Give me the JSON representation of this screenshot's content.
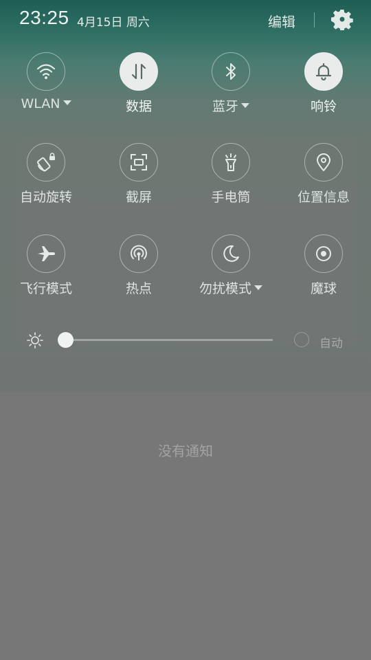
{
  "status": {
    "time": "23:25",
    "date": "4月15日",
    "weekday": "周六",
    "edit_label": "编辑"
  },
  "tiles": [
    {
      "label": "WLAN",
      "icon": "wifi-icon",
      "active": false,
      "has_menu": true
    },
    {
      "label": "数据",
      "icon": "mobile-data-icon",
      "active": true,
      "has_menu": false
    },
    {
      "label": "蓝牙",
      "icon": "bluetooth-icon",
      "active": false,
      "has_menu": true
    },
    {
      "label": "响铃",
      "icon": "bell-icon",
      "active": true,
      "has_menu": false
    },
    {
      "label": "自动旋转",
      "icon": "rotation-lock-icon",
      "active": false,
      "has_menu": false
    },
    {
      "label": "截屏",
      "icon": "screenshot-icon",
      "active": false,
      "has_menu": false
    },
    {
      "label": "手电筒",
      "icon": "flashlight-icon",
      "active": false,
      "has_menu": false
    },
    {
      "label": "位置信息",
      "icon": "location-icon",
      "active": false,
      "has_menu": false
    },
    {
      "label": "飞行模式",
      "icon": "airplane-icon",
      "active": false,
      "has_menu": false
    },
    {
      "label": "热点",
      "icon": "hotspot-icon",
      "active": false,
      "has_menu": false
    },
    {
      "label": "勿扰模式",
      "icon": "moon-icon",
      "active": false,
      "has_menu": true
    },
    {
      "label": "魔球",
      "icon": "floating-ball-icon",
      "active": false,
      "has_menu": false
    }
  ],
  "brightness": {
    "level": 0.0,
    "auto_label": "自动",
    "auto_enabled": false
  },
  "notifications": {
    "empty_text": "没有通知"
  }
}
